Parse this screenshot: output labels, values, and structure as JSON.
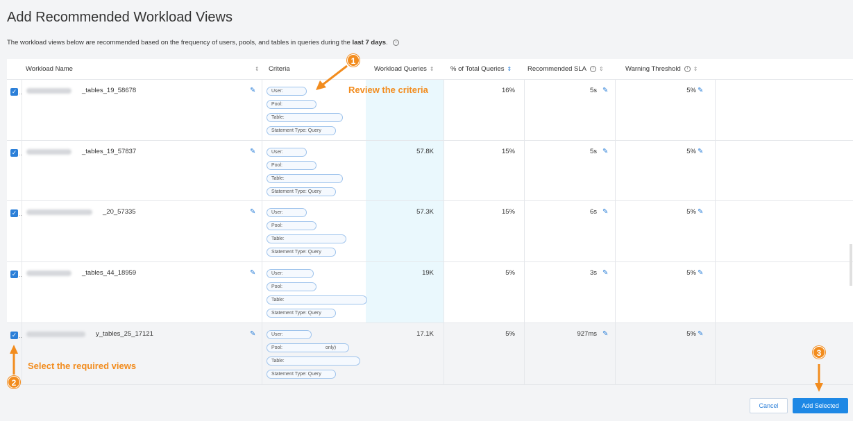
{
  "header": {
    "title": "Add Recommended Workload Views",
    "subtitle_pre": "The workload views below are recommended based on the frequency of users, pools, and tables in queries during the ",
    "subtitle_bold": "last 7 days",
    "subtitle_post": "."
  },
  "columns": {
    "name": "Workload Name",
    "criteria": "Criteria",
    "queries": "Workload Queries",
    "pct": "% of Total Queries",
    "sla": "Recommended SLA",
    "warn": "Warning Threshold"
  },
  "criteria_labels": {
    "user": "User:",
    "pool": "Pool:",
    "table": "Table:",
    "stmt": "Statement Type: Query",
    "pool_last_suffix": "only)"
  },
  "rows": [
    {
      "name": "_tables_19_58678",
      "queries": "",
      "pct": "16%",
      "sla": "5s",
      "warn": "5%"
    },
    {
      "name": "_tables_19_57837",
      "queries": "57.8K",
      "pct": "15%",
      "sla": "5s",
      "warn": "5%"
    },
    {
      "name": "_20_57335",
      "queries": "57.3K",
      "pct": "15%",
      "sla": "6s",
      "warn": "5%"
    },
    {
      "name": "_tables_44_18959",
      "queries": "19K",
      "pct": "5%",
      "sla": "3s",
      "warn": "5%"
    },
    {
      "name": "y_tables_25_17121",
      "queries": "17.1K",
      "pct": "5%",
      "sla": "927ms",
      "warn": "5%"
    }
  ],
  "annotations": {
    "c1": "1",
    "c2": "2",
    "c3": "3",
    "t1": "Review the criteria",
    "t2": "Select the required views"
  },
  "buttons": {
    "cancel": "Cancel",
    "add": "Add Selected"
  },
  "colors": {
    "accent": "#2b7fd8",
    "annotation": "#f28c1e",
    "highlight": "#eaf8fd"
  }
}
